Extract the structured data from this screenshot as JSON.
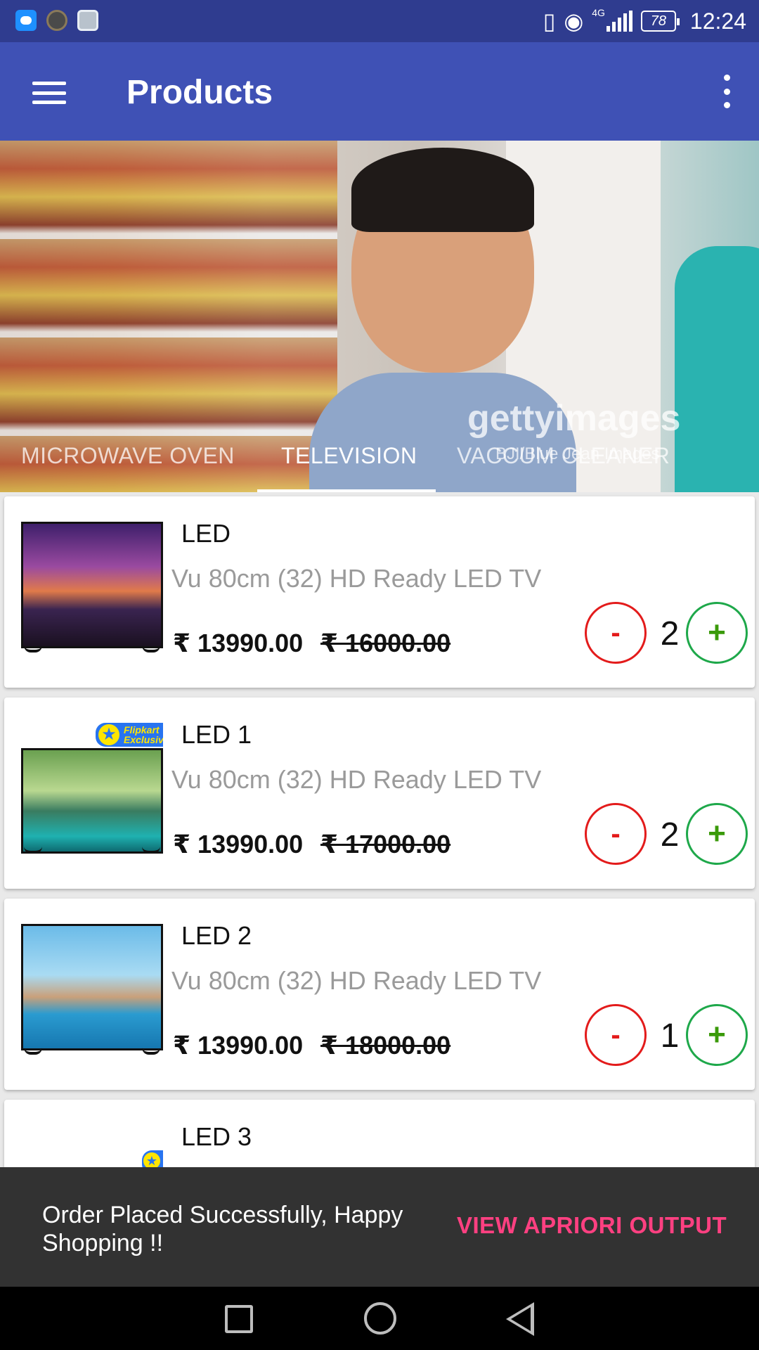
{
  "status_bar": {
    "icons": [
      "message-icon",
      "avatar-icon",
      "gallery-icon",
      "vibrate-icon",
      "eye-icon",
      "signal-icon",
      "battery-icon"
    ],
    "network": "4G",
    "battery": "78",
    "time": "12:24"
  },
  "appbar": {
    "title": "Products",
    "menu_icon": "hamburger-menu-icon",
    "overflow_icon": "more-vert-icon"
  },
  "banner": {
    "watermark": "gettyimages",
    "watermark_sub": "BJI/Blue Jean Images",
    "tabs": [
      {
        "label": "MICROWAVE OVEN",
        "active": false
      },
      {
        "label": "TELEVISION",
        "active": true
      },
      {
        "label": "VACCUM CLEANER",
        "active": false
      }
    ]
  },
  "products": [
    {
      "name": "LED",
      "description": "Vu 80cm (32) HD Ready LED TV",
      "price": "₹ 13990.00",
      "mrp": "₹ 16000.00",
      "qty": "2",
      "minus": "-",
      "plus": "+"
    },
    {
      "name": "LED 1",
      "description": "Vu 80cm (32) HD Ready LED TV",
      "price": "₹ 13990.00",
      "mrp": "₹ 17000.00",
      "qty": "2",
      "minus": "-",
      "plus": "+",
      "badge": "Flipkart Exclusive"
    },
    {
      "name": "LED 2",
      "description": "Vu 80cm (32) HD Ready LED TV",
      "price": "₹ 13990.00",
      "mrp": "₹ 18000.00",
      "qty": "1",
      "minus": "-",
      "plus": "+"
    },
    {
      "name": "LED 3"
    }
  ],
  "snackbar": {
    "message": "Order Placed Successfully, Happy Shopping !!",
    "action": "VIEW APRIORI OUTPUT",
    "action_color": "#ff4081"
  },
  "colors": {
    "primary": "#3f51b5",
    "primary_dark": "#2f3c8f",
    "minus": "#e31b1b",
    "plus": "#1ea84a"
  }
}
